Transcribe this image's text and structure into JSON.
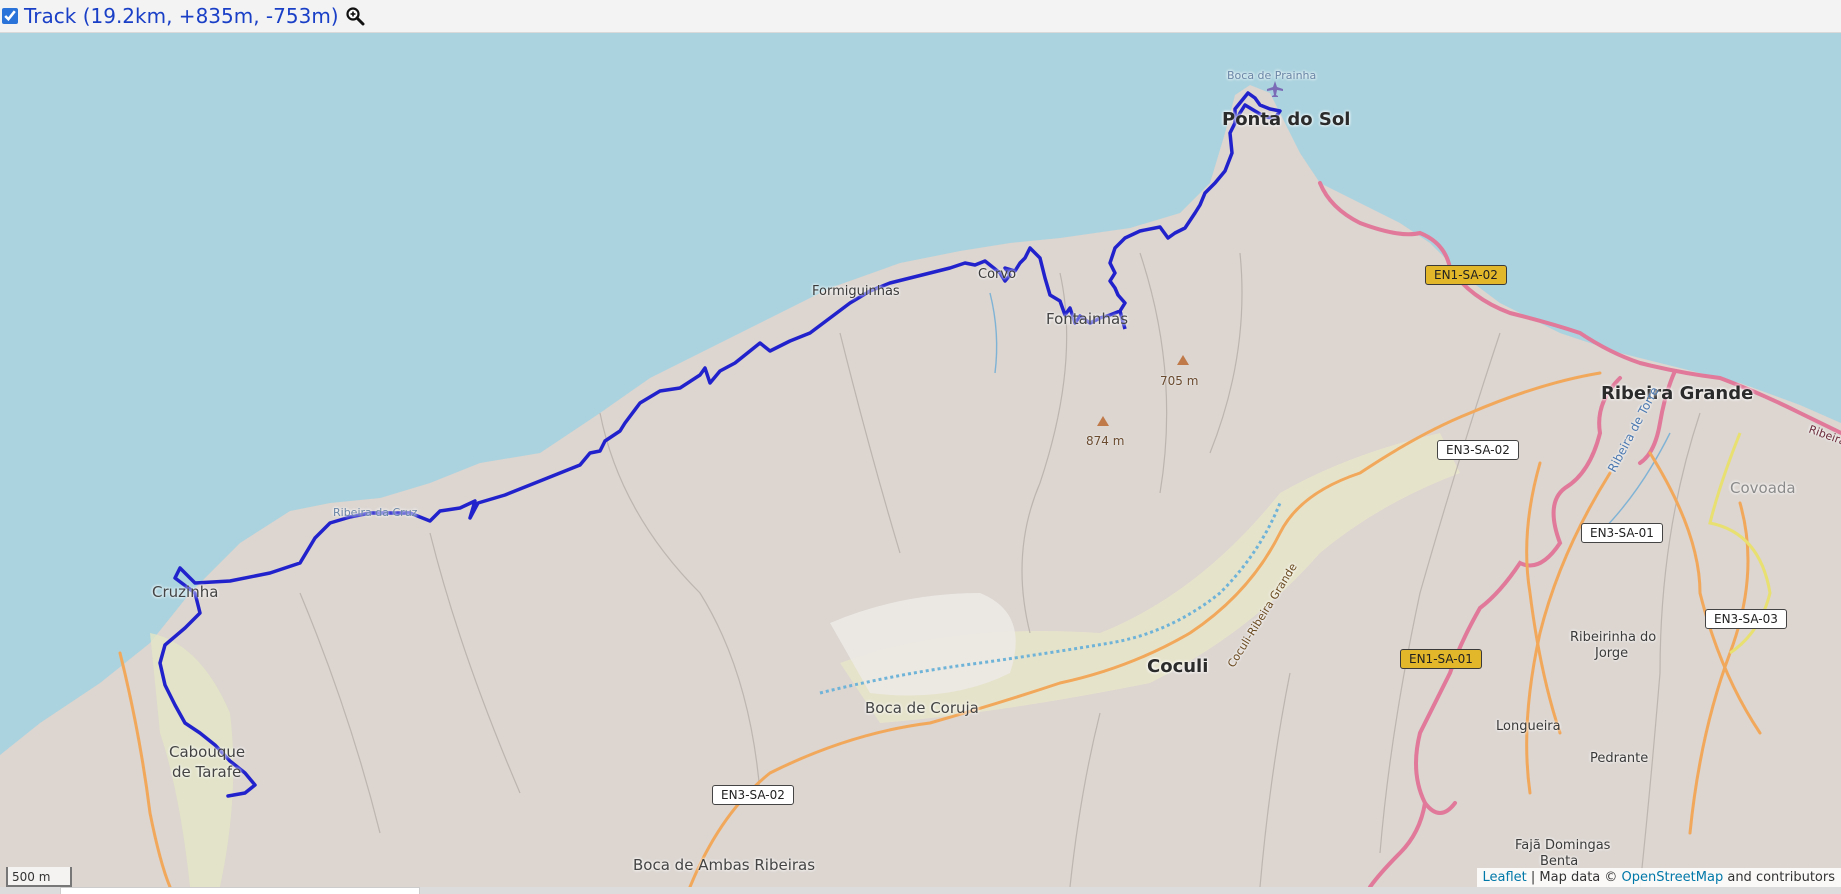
{
  "header": {
    "track_checked": true,
    "track_label": "Track (19.2km, +835m, -753m)"
  },
  "colors": {
    "sea": "#aad3df",
    "land": "#dcd5d0",
    "track": "#2222cc",
    "primary_road": "#e0799a",
    "secondary_road": "#f2a85a"
  },
  "places": {
    "ponta_do_sol": "Ponta do Sol",
    "boca_de_prainha": "Boca de Prainha",
    "ribeira_grande": "Ribeira Grande",
    "coculi": "Coculi",
    "boca_de_coruja": "Boca de Coruja",
    "boca_de_ambas_ribeiras": "Boca de Ambas Ribeiras",
    "formiguinhas": "Formiguinhas",
    "corvo": "Corvo",
    "fontainhas": "Fontainhas",
    "cruzinha": "Cruzinha",
    "ribeira_de_cruz": "Ribeira da Cruz",
    "cabouque_line1": "Cabouque",
    "cabouque_line2": "de Tarafe",
    "covoada": "Covoada",
    "ribeirinha_line1": "Ribeirinha do",
    "ribeirinha_line2": "Jorge",
    "longueira": "Longueira",
    "pedrante": "Pedrante",
    "faja_line1": "Fajã Domingas",
    "faja_line2": "Benta",
    "ribeira_de_torre": "Ribeira de Torre",
    "coculi_road": "Coculi-Ribeira Grande"
  },
  "peaks": {
    "peak1": "705 m",
    "peak2": "874 m"
  },
  "roads": {
    "en1_sa_02": "EN1-SA-02",
    "en1_sa_01": "EN1-SA-01",
    "en3_sa_02_a": "EN3-SA-02",
    "en3_sa_02_b": "EN3-SA-02",
    "en3_sa_01": "EN3-SA-01",
    "en3_sa_03": "EN3-SA-03",
    "ribeira_edge": "Ribeira"
  },
  "scale": {
    "label": "500 m"
  },
  "attribution": {
    "leaflet": "Leaflet",
    "sep": " | Map data © ",
    "osm": "OpenStreetMap",
    "contrib": " and contributors"
  }
}
